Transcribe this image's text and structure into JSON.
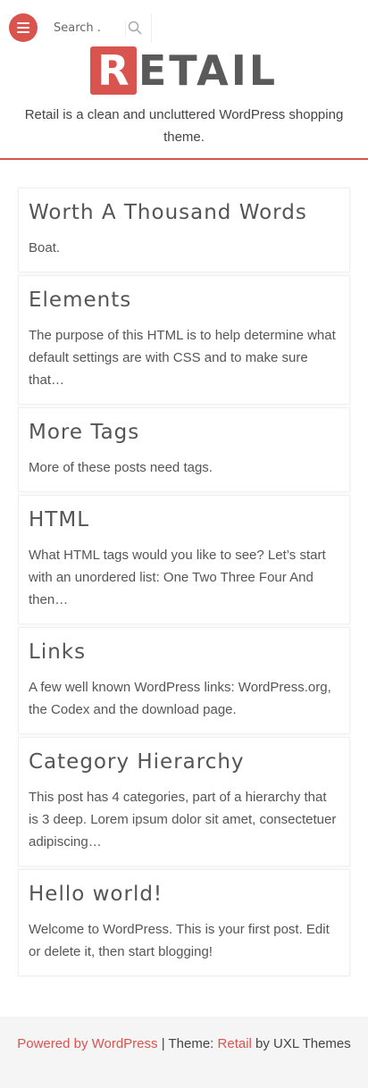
{
  "header": {
    "search_placeholder": "Search .",
    "logo_letter": "R",
    "logo_rest": "ETAIL",
    "tagline": "Retail is a clean and uncluttered WordPress shopping theme."
  },
  "posts": [
    {
      "title": "Worth A Thousand Words",
      "excerpt": "Boat."
    },
    {
      "title": "Elements",
      "excerpt": "The purpose of this HTML is to help determine what default settings are with CSS and to make sure that…"
    },
    {
      "title": "More Tags",
      "excerpt": "More of these posts need tags."
    },
    {
      "title": "HTML",
      "excerpt": "What HTML tags would you like to see? Let’s start with an unordered list: One Two Three Four And then…"
    },
    {
      "title": "Links",
      "excerpt": "A few well known WordPress links: WordPress.org, the Codex and the download page."
    },
    {
      "title": "Category Hierarchy",
      "excerpt": "This post has 4 categories, part of a hierarchy that is 3 deep. Lorem ipsum dolor sit amet, consectetuer adipiscing…"
    },
    {
      "title": "Hello world!",
      "excerpt": "Welcome to WordPress. This is your first post. Edit or delete it, then start blogging!"
    }
  ],
  "footer": {
    "powered_by": "Powered by WordPress",
    "separator": " | Theme: ",
    "theme_name": "Retail",
    "by_text": " by UXL Themes"
  },
  "colors": {
    "accent": "#d9534f",
    "text": "#555555",
    "footer_bg": "#f5f5f5"
  },
  "icons": {
    "menu": "hamburger-icon",
    "search": "search-icon"
  }
}
